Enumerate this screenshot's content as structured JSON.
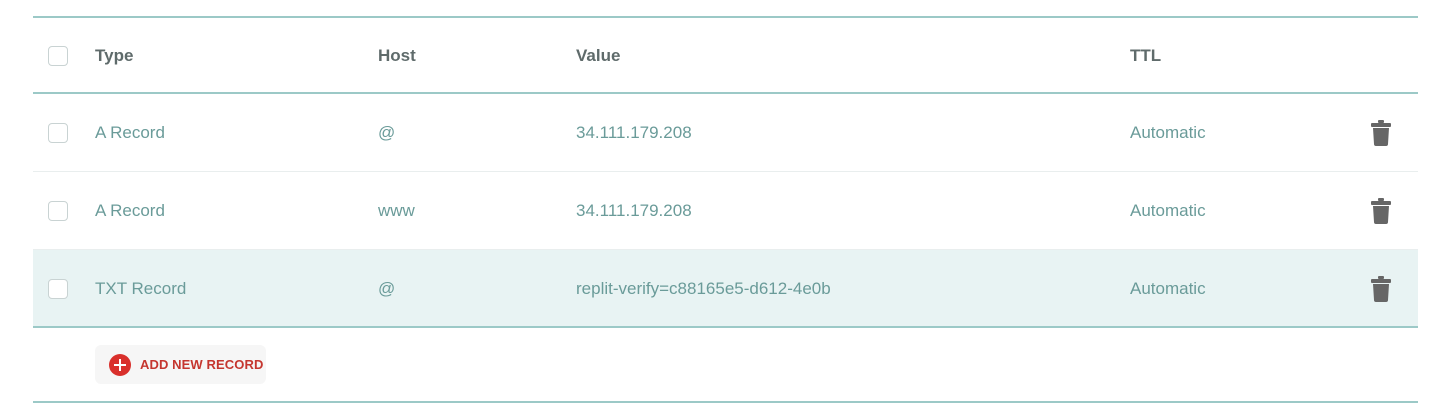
{
  "table": {
    "columns": {
      "type": "Type",
      "host": "Host",
      "value": "Value",
      "ttl": "TTL"
    },
    "records": [
      {
        "type": "A Record",
        "host": "@",
        "value": "34.111.179.208",
        "ttl": "Automatic"
      },
      {
        "type": "A Record",
        "host": "www",
        "value": "34.111.179.208",
        "ttl": "Automatic"
      },
      {
        "type": "TXT Record",
        "host": "@",
        "value": "replit-verify=c88165e5-d612-4e0b",
        "ttl": "Automatic"
      }
    ]
  },
  "actions": {
    "add_label": "ADD NEW RECORD"
  },
  "icons": {
    "delete": "trash-icon",
    "add": "plus-circle-icon"
  },
  "colors": {
    "accent_red": "#d9302c",
    "teal_text": "#6a9b99",
    "row_highlight": "#e8f3f3",
    "divider_teal": "#9cc9c7"
  }
}
